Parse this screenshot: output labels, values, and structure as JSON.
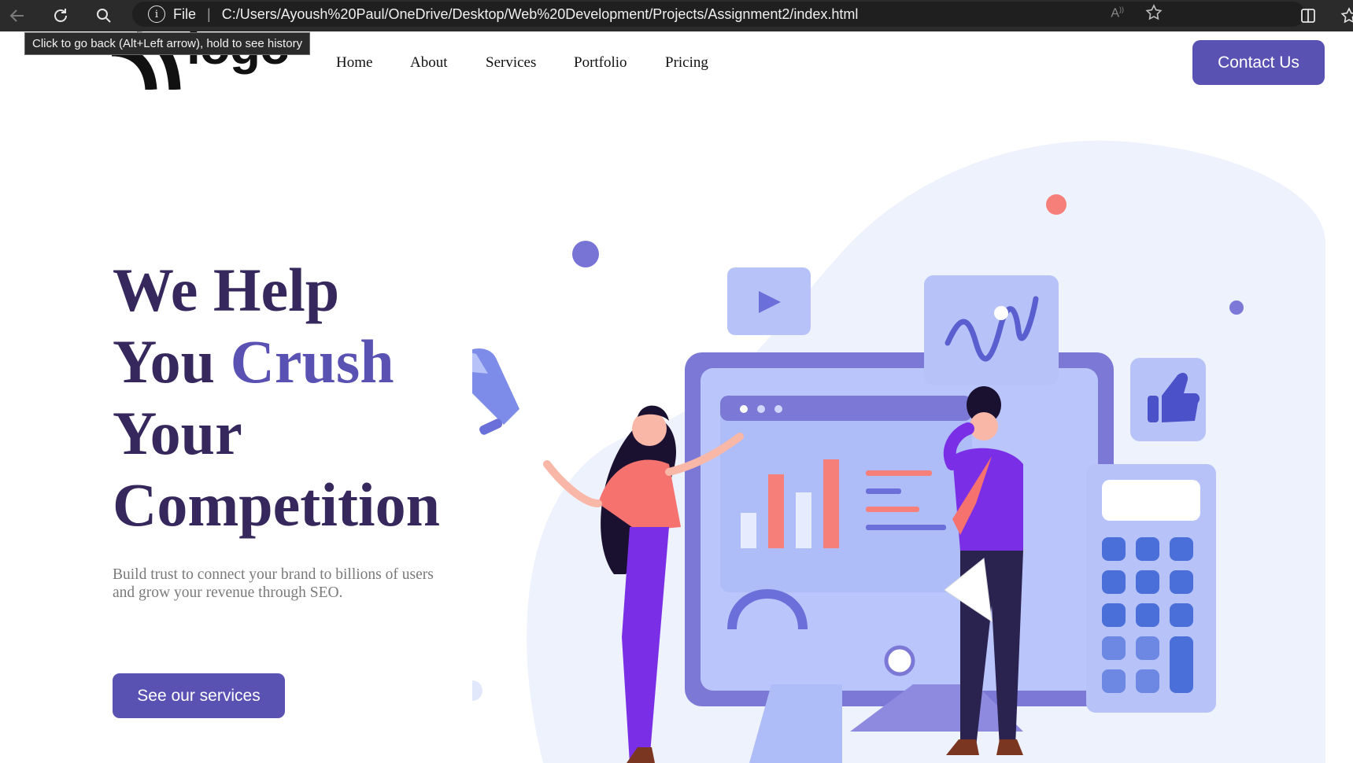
{
  "browser": {
    "address_prefix": "File",
    "url": "C:/Users/Ayoush%20Paul/OneDrive/Desktop/Web%20Development/Projects/Assignment2/index.html",
    "tooltip": "Click to go back (Alt+Left arrow), hold to see history",
    "icons": [
      "back-arrow-icon",
      "refresh-icon",
      "search-icon",
      "info-icon",
      "read-aloud-icon",
      "favorite-star-icon",
      "split-screen-icon",
      "favorites-icon"
    ]
  },
  "header": {
    "logo_text": "logo",
    "nav": [
      "Home",
      "About",
      "Services",
      "Portfolio",
      "Pricing"
    ],
    "contact_label": "Contact Us"
  },
  "hero": {
    "title_line1": "We Help",
    "title_line2_a": "You ",
    "title_line2_b": "Crush",
    "title_line3": "Your",
    "title_line4": "Competition",
    "subtitle": "Build trust to connect your brand to billions of users and grow your revenue through SEO.",
    "cta_label": "See our services"
  },
  "colors": {
    "brand": "#5a52b3",
    "title": "#36275c",
    "subtitle": "#7a7a7a",
    "chrome": "#2b2b2b"
  }
}
